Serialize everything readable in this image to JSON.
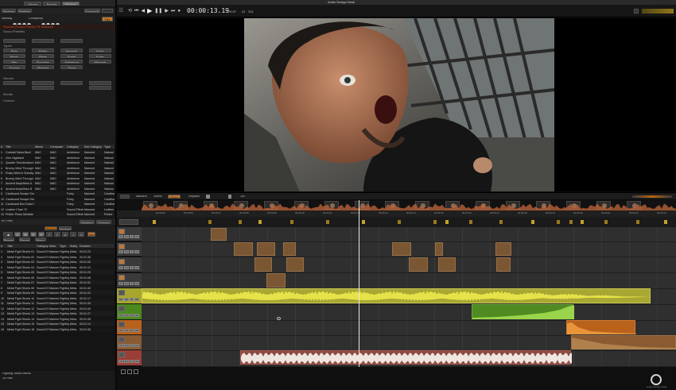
{
  "window": {
    "title": "Audio Design Desk"
  },
  "left_panel": {
    "top_tabs": [
      "Library",
      "Search",
      "Markers"
    ],
    "tab_labels": [
      "Browse",
      "Settings"
    ],
    "keywords_label": "Keywords",
    "favorites_label": "Favorites",
    "intensity_label": "Intensity",
    "complexity_label": "Complexity",
    "fav_button": "Fav",
    "sections": [
      "Sounds (Sound Packs) 78 Selected",
      "Sound Palettes",
      "Types",
      "Genres",
      "Moods",
      "Custom"
    ],
    "grid_buttons": [
      "Fists",
      "Fights",
      "Impacts",
      "Kicks",
      "Music",
      "Rises",
      "Swish",
      "Foley",
      "Hits",
      "Punches",
      "Ambience",
      "Whoosh",
      "Drones",
      "Stingers",
      "Tonal"
    ],
    "table_headers": [
      "#",
      "Title",
      "Album",
      "Composer",
      "Category",
      "Sub Category",
      "Type"
    ],
    "table_rows": [
      [
        "1",
        "Cocktail Salsa Bowl",
        "M&C",
        "M&C",
        "Ambience",
        "Manned",
        "Natural"
      ],
      [
        "2",
        "Dive Nightclub",
        "M&C",
        "M&C",
        "Ambience",
        "Manned",
        "Natural"
      ],
      [
        "3",
        "Quarter Thunderstorm",
        "M&C",
        "M&C",
        "Ambience",
        "Manned",
        "Natural"
      ],
      [
        "4",
        "Breezy Wind Through",
        "M&C",
        "M&C",
        "Ambience",
        "Manned",
        "Natural"
      ],
      [
        "5",
        "Rusty Wind in Sunday",
        "M&C",
        "M&C",
        "Ambience",
        "Manned",
        "Natural"
      ],
      [
        "6",
        "Breezy Wind Through",
        "M&C",
        "M&C",
        "Ambience",
        "Manned",
        "Natural"
      ],
      [
        "7",
        "Ancient Amphibian A",
        "M&C",
        "M&C",
        "Ambience",
        "Manned",
        "Natural"
      ],
      [
        "8",
        "Ancient Amphibian B",
        "M&C",
        "M&C",
        "Ambience",
        "Manned",
        "Natural"
      ],
      [
        "9",
        "Cardboard Scrape Sma",
        "",
        "",
        "Foley",
        "Manned",
        "Cardboard"
      ],
      [
        "10",
        "Cardboard Scrape Glas",
        "",
        "",
        "Foley",
        "Manned",
        "Cardboard"
      ],
      [
        "11",
        "Cardboard Box Draw 01",
        "",
        "",
        "Foley",
        "Manned",
        "Cardboard"
      ],
      [
        "12",
        "Leather Chair 79",
        "",
        "",
        "Sound Effects",
        "Manned",
        "Leather"
      ],
      [
        "13",
        "Printer Photo Mediate",
        "",
        "",
        "Sound Effects",
        "Manned",
        "Printer"
      ]
    ],
    "mid_tabs": [
      "Palettes",
      "Triggers"
    ],
    "sub_tabs": [
      "Triggers",
      "Markers"
    ],
    "aux_label": "MT Files",
    "small_buttons": [
      "Browse",
      "Range",
      "Menu"
    ],
    "keypad": [
      "Q",
      "W",
      "E",
      "R",
      "T",
      "Y",
      "U",
      "I",
      "O"
    ],
    "add_button": "Add",
    "mode_label": "Both",
    "list_headers": [
      "#",
      "Title",
      "Category",
      "Subc.",
      "Type",
      "Subty",
      "Duration"
    ],
    "list_rows": [
      [
        "1",
        "Metal Fight Shorts 01",
        "Sound Ef.",
        "Manned",
        "Fighting",
        "Meta.",
        "00:01:23"
      ],
      [
        "2",
        "Metal Fight Shorts 02",
        "Sound Ef.",
        "Manned",
        "Fighting",
        "Meta.",
        "00:01:38"
      ],
      [
        "3",
        "Metal Fight Shorts 03",
        "Sound Ef.",
        "Manned",
        "Fighting",
        "Meta.",
        "00:01:05"
      ],
      [
        "4",
        "Metal Fight Shorts 04",
        "Sound Ef.",
        "Manned",
        "Fighting",
        "Meta.",
        "00:01:12"
      ],
      [
        "5",
        "Metal Fight Shorts 05",
        "Sound Ef.",
        "Manned",
        "Fighting",
        "Meta.",
        "00:01:29"
      ],
      [
        "6",
        "Metal Fight Shorts 06",
        "Sound Ef.",
        "Manned",
        "Fighting",
        "Meta.",
        "00:01:08"
      ],
      [
        "7",
        "Metal Fight Shorts 07",
        "Sound Ef.",
        "Manned",
        "Fighting",
        "Meta.",
        "00:01:51"
      ],
      [
        "8",
        "Metal Fight Shorts 08",
        "Sound Ef.",
        "Manned",
        "Fighting",
        "Meta.",
        "00:01:40"
      ],
      [
        "9",
        "Metal Fight Shorts 09",
        "Sound Ef.",
        "Manned",
        "Fighting",
        "Meta.",
        "00:01:22"
      ],
      [
        "10",
        "Metal Fight Shorts 10",
        "Sound Ef.",
        "Manned",
        "Fighting",
        "Meta.",
        "00:01:17"
      ],
      [
        "11",
        "Metal Fight Shorts 11",
        "Sound Ef.",
        "Manned",
        "Fighting",
        "Meta.",
        "00:01:33"
      ],
      [
        "12",
        "Metal Fight Shorts 12",
        "Sound Ef.",
        "Manned",
        "Fighting",
        "Meta.",
        "00:01:09"
      ],
      [
        "13",
        "Metal Fight Shorts 13",
        "Sound Ef.",
        "Manned",
        "Fighting",
        "Meta.",
        "00:01:27"
      ],
      [
        "14",
        "Metal Fight Shorts 14",
        "Sound Ef.",
        "Manned",
        "Fighting",
        "Meta.",
        "00:01:45"
      ],
      [
        "15",
        "Metal Fight Shorts 15",
        "Sound Ef.",
        "Manned",
        "Fighting",
        "Meta.",
        "00:01:14"
      ],
      [
        "16",
        "Metal Fight Shorts 16",
        "Sound Ef.",
        "Manned",
        "Fighting",
        "Meta.",
        "00:01:36"
      ]
    ],
    "footer_label": "Fighting, Metal Effects",
    "footer_count": "16 Files"
  },
  "transport": {
    "timecode": "00:00:13.19",
    "fps": "29.97",
    "bpm": "24",
    "bars": "331"
  },
  "timeline_toolbar": {
    "items": [
      "Markers",
      "Select",
      "Snap",
      "Replace"
    ],
    "zoom": "100"
  },
  "timecodes": [
    "00:00:05",
    "00:00:06",
    "00:00:07",
    "00:00:08",
    "00:00:09",
    "00:00:10",
    "00:00:11",
    "00:00:12",
    "00:00:13",
    "00:00:14",
    "00:00:15",
    "00:00:16",
    "00:00:17",
    "00:00:18",
    "00:00:19",
    "00:00:20",
    "00:00:21",
    "00:00:22",
    "00:00:23"
  ],
  "colors": {
    "accent": "#d17a22",
    "clip_brown": "#7a5632",
    "clip_yellow": "#b5b536",
    "clip_green": "#4f9a1f",
    "clip_orange": "#c06a1e",
    "clip_red": "#9a4a40"
  },
  "brand": {
    "name": "Audio Design Desk"
  }
}
